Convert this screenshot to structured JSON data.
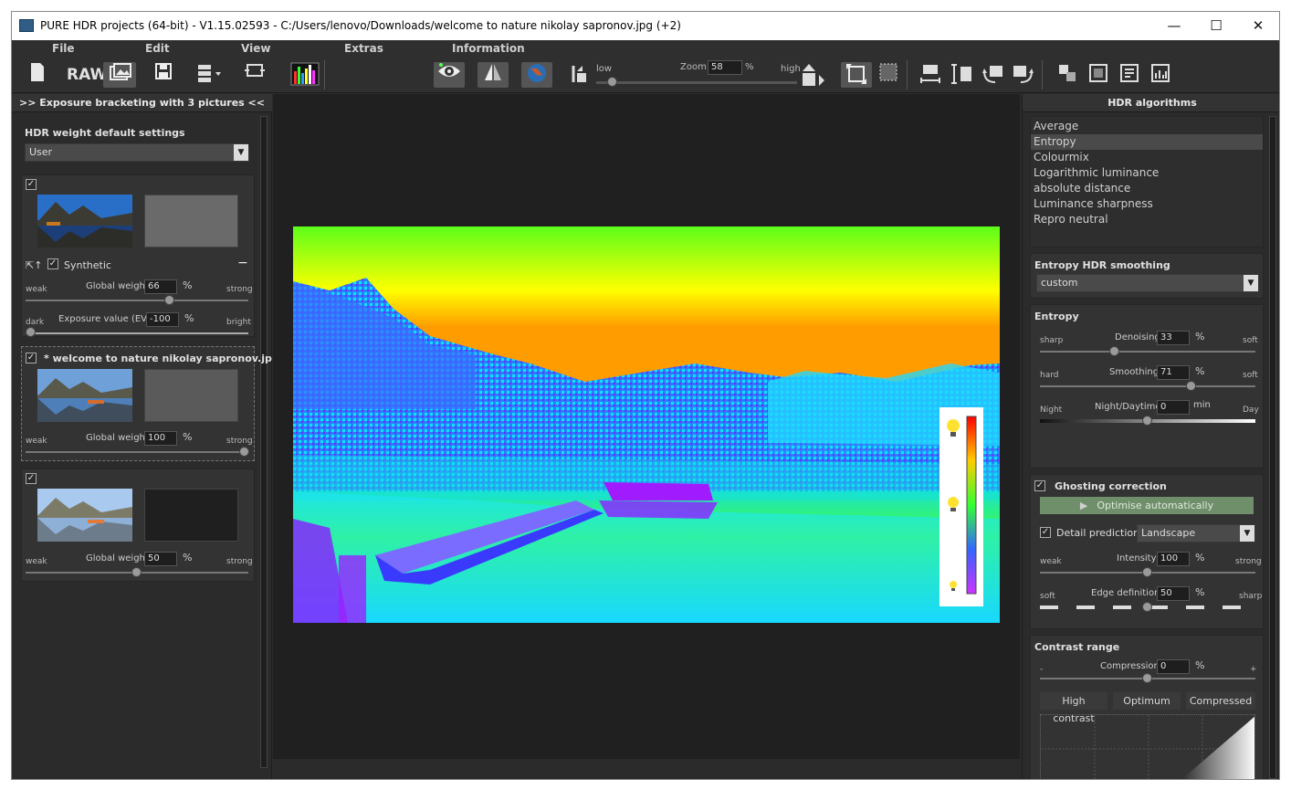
{
  "window": {
    "title": "PURE HDR projects (64-bit) - V1.15.02593 - C:/Users/lenovo/Downloads/welcome to nature nikolay sapronov.jpg (+2)",
    "minimize": "—",
    "maximize": "☐",
    "close": "✕"
  },
  "menu": [
    "File",
    "Edit",
    "View",
    "Extras",
    "Information"
  ],
  "toolbar": {
    "raw_label": "RAW",
    "zoom_label": "Zoom",
    "zoom_value": "58",
    "zoom_unit": "%",
    "low_label": "low",
    "high_label": "high"
  },
  "left_panel": {
    "header": ">> Exposure bracketing with 3 pictures <<",
    "defaults_title": "HDR weight default settings",
    "defaults_value": "User",
    "images": [
      {
        "name": "Synthetic",
        "global_weight_label": "Global weight",
        "weight": "66",
        "unit": "%",
        "weak": "weak",
        "strong": "strong",
        "weight_fraction": 0.66,
        "ev_label": "Exposure value (EV)",
        "ev": "-100",
        "ev_unit": "%",
        "dark": "dark",
        "bright": "bright",
        "remove": "−"
      },
      {
        "name": "* welcome to nature nikolay sapronov.jp",
        "global_weight_label": "Global weight",
        "weight": "100",
        "unit": "%",
        "weak": "weak",
        "strong": "strong",
        "weight_fraction": 1.0
      },
      {
        "global_weight_label": "Global weight",
        "weight": "50",
        "unit": "%",
        "weak": "weak",
        "strong": "strong",
        "weight_fraction": 0.5
      }
    ]
  },
  "right_panel": {
    "header": "HDR algorithms",
    "algorithms": [
      "Average",
      "Entropy",
      "Colourmix",
      "Logarithmic luminance",
      "absolute distance",
      "Luminance sharpness",
      "Repro neutral"
    ],
    "selected_algorithm": "Entropy",
    "smoothing_title": "Entropy HDR smoothing",
    "smoothing_value": "custom",
    "entropy_title": "Entropy",
    "denoising": {
      "label": "Denoising",
      "value": "33",
      "unit": "%",
      "left": "sharp",
      "right": "soft",
      "fraction": 0.33
    },
    "smoothing": {
      "label": "Smoothing",
      "value": "71",
      "unit": "%",
      "left": "hard",
      "right": "soft",
      "fraction": 0.71
    },
    "night": {
      "label": "Night/Daytime",
      "value": "0",
      "unit": "min",
      "left": "Night",
      "right": "Day",
      "fraction": 0.5
    },
    "ghosting_title": "Ghosting correction",
    "optimise_label": "Optimise automatically",
    "detail_label": "Detail prediction",
    "detail_value": "Landscape",
    "intensity": {
      "label": "Intensity",
      "value": "100",
      "unit": "%",
      "left": "weak",
      "right": "strong",
      "fraction": 0.5
    },
    "edge": {
      "label": "Edge definition",
      "value": "50",
      "unit": "%",
      "left": "soft",
      "right": "sharp",
      "fraction": 0.5
    },
    "contrast_title": "Contrast range",
    "compression": {
      "label": "Compression",
      "value": "0",
      "unit": "%",
      "left": "-",
      "right": "+",
      "fraction": 0.5
    },
    "presets": [
      "High contrast",
      "Optimum",
      "Compressed"
    ]
  },
  "colors": {
    "background": "#2b2b2b",
    "panel": "#333333",
    "accent_green": "#6f8f6a"
  },
  "icons": [
    "new-icon",
    "raw-icon",
    "gallery-icon",
    "save-icon",
    "export-icon",
    "compare-icon",
    "histogram-icon",
    "eye-icon",
    "mirror-icon",
    "globe-icon",
    "fit-icon",
    "crop-icon",
    "width-icon",
    "height-icon",
    "rotate-left-icon",
    "rotate-right-icon"
  ]
}
